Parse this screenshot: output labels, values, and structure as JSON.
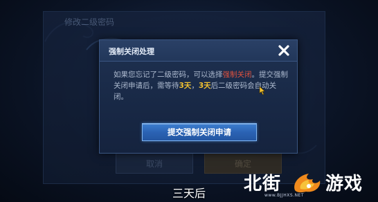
{
  "background_panel": {
    "title": "修改二级密码",
    "cancel_label": "取消",
    "confirm_label": "确定"
  },
  "dialog": {
    "title": "强制关闭处理",
    "close_icon": "close-x-icon",
    "body": {
      "part1": "如果您忘记了二级密码，可以选择",
      "highlight_action": "强制关闭",
      "part2": "。提交强制关闭申请后，需等待",
      "days_1": "3天",
      "part3": "，",
      "days_2": "3天",
      "part4": "后二级密码会自动关闭。"
    },
    "submit_label": "提交强制关闭申请"
  },
  "subtitle": "三天后",
  "watermark": {
    "left_text": "北街",
    "right_text": "游戏",
    "url": "www.BJJHXS.NET"
  },
  "colors": {
    "accent_red": "#e0523e",
    "accent_yellow": "#f2c230",
    "button_blue": "#2b63b4"
  }
}
